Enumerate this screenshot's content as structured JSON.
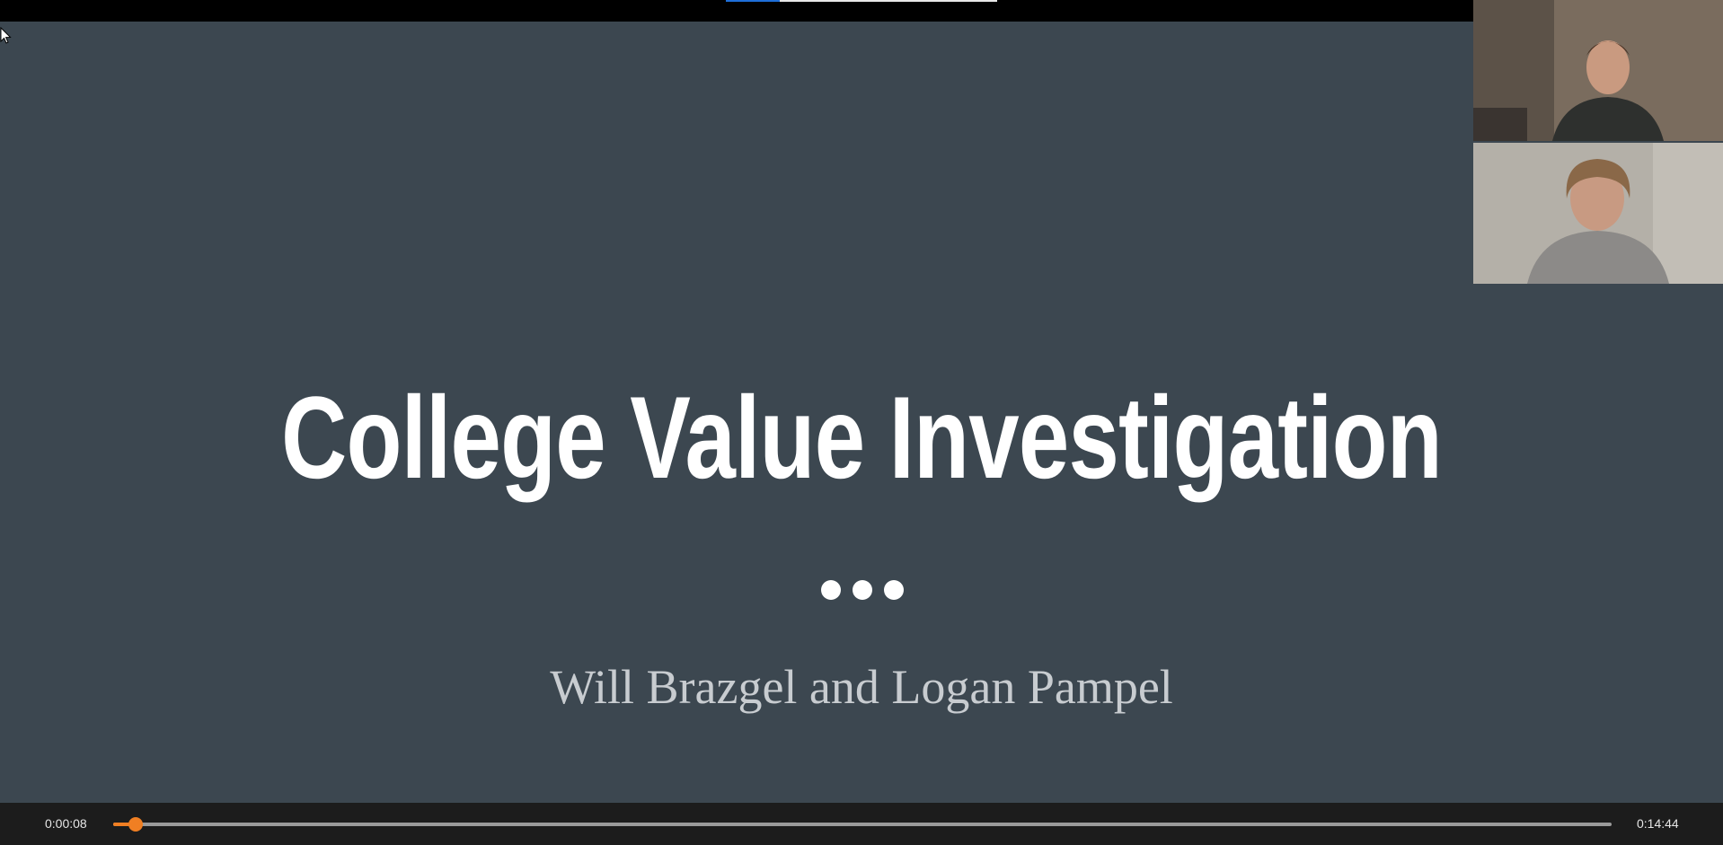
{
  "slide": {
    "title": "College Value Investigation",
    "subtitle": "Will Brazgel and Logan Pampel",
    "background_color": "#3c4750"
  },
  "player": {
    "current_time": "0:00:08",
    "total_time": "0:14:44",
    "progress_fraction": 0.009,
    "accent_color": "#f07f23"
  },
  "participants": [
    {
      "tile": "participant-video-1"
    },
    {
      "tile": "participant-video-2"
    }
  ],
  "icons": {
    "cursor": "mouse-pointer-icon"
  }
}
